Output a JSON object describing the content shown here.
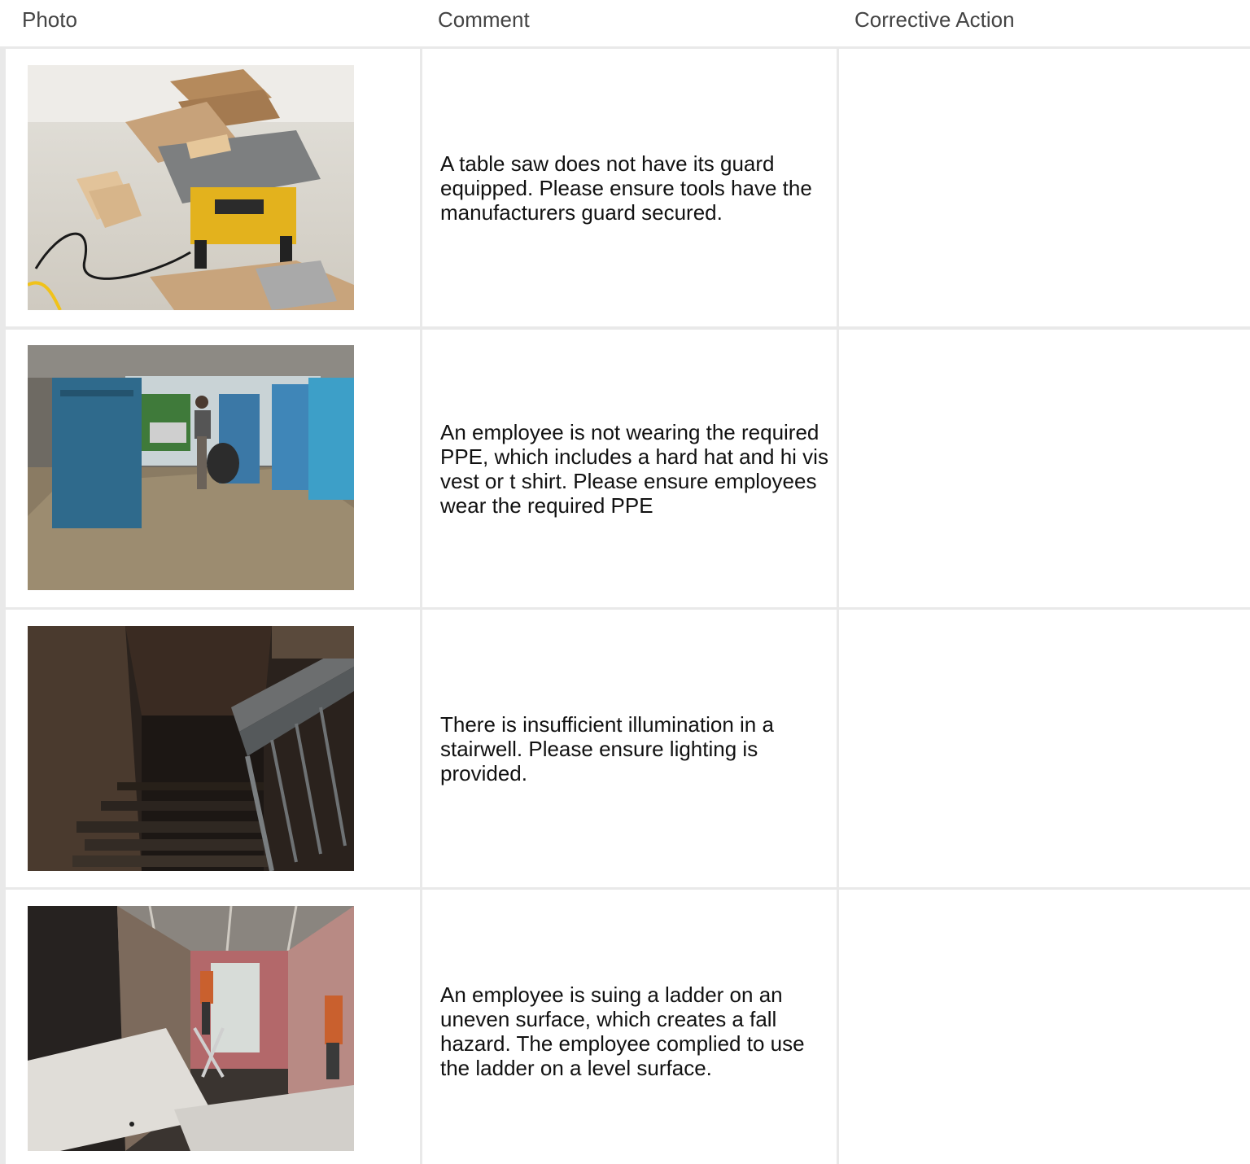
{
  "header": {
    "photo_label": "Photo",
    "comment_label": "Comment",
    "corrective_action_label": "Corrective Action"
  },
  "rows": [
    {
      "photo": "table-saw-photo",
      "comment": "A table saw does not have its guard equipped. Please ensure tools have the manufacturers guard secured.",
      "corrective_action": ""
    },
    {
      "photo": "employee-ppe-photo",
      "comment": "An employee is not wearing the required PPE, which includes a hard hat and hi vis vest or t shirt. Please ensure employees wear the required PPE",
      "corrective_action": ""
    },
    {
      "photo": "dark-stairwell-photo",
      "comment": "There is insufficient illumination in a stairwell. Please ensure lighting is provided.",
      "corrective_action": ""
    },
    {
      "photo": "ladder-uneven-surface-photo",
      "comment": "An employee is suing a ladder on an uneven surface, which creates a fall hazard. The employee complied to use the ladder on a level surface.",
      "corrective_action": ""
    }
  ]
}
